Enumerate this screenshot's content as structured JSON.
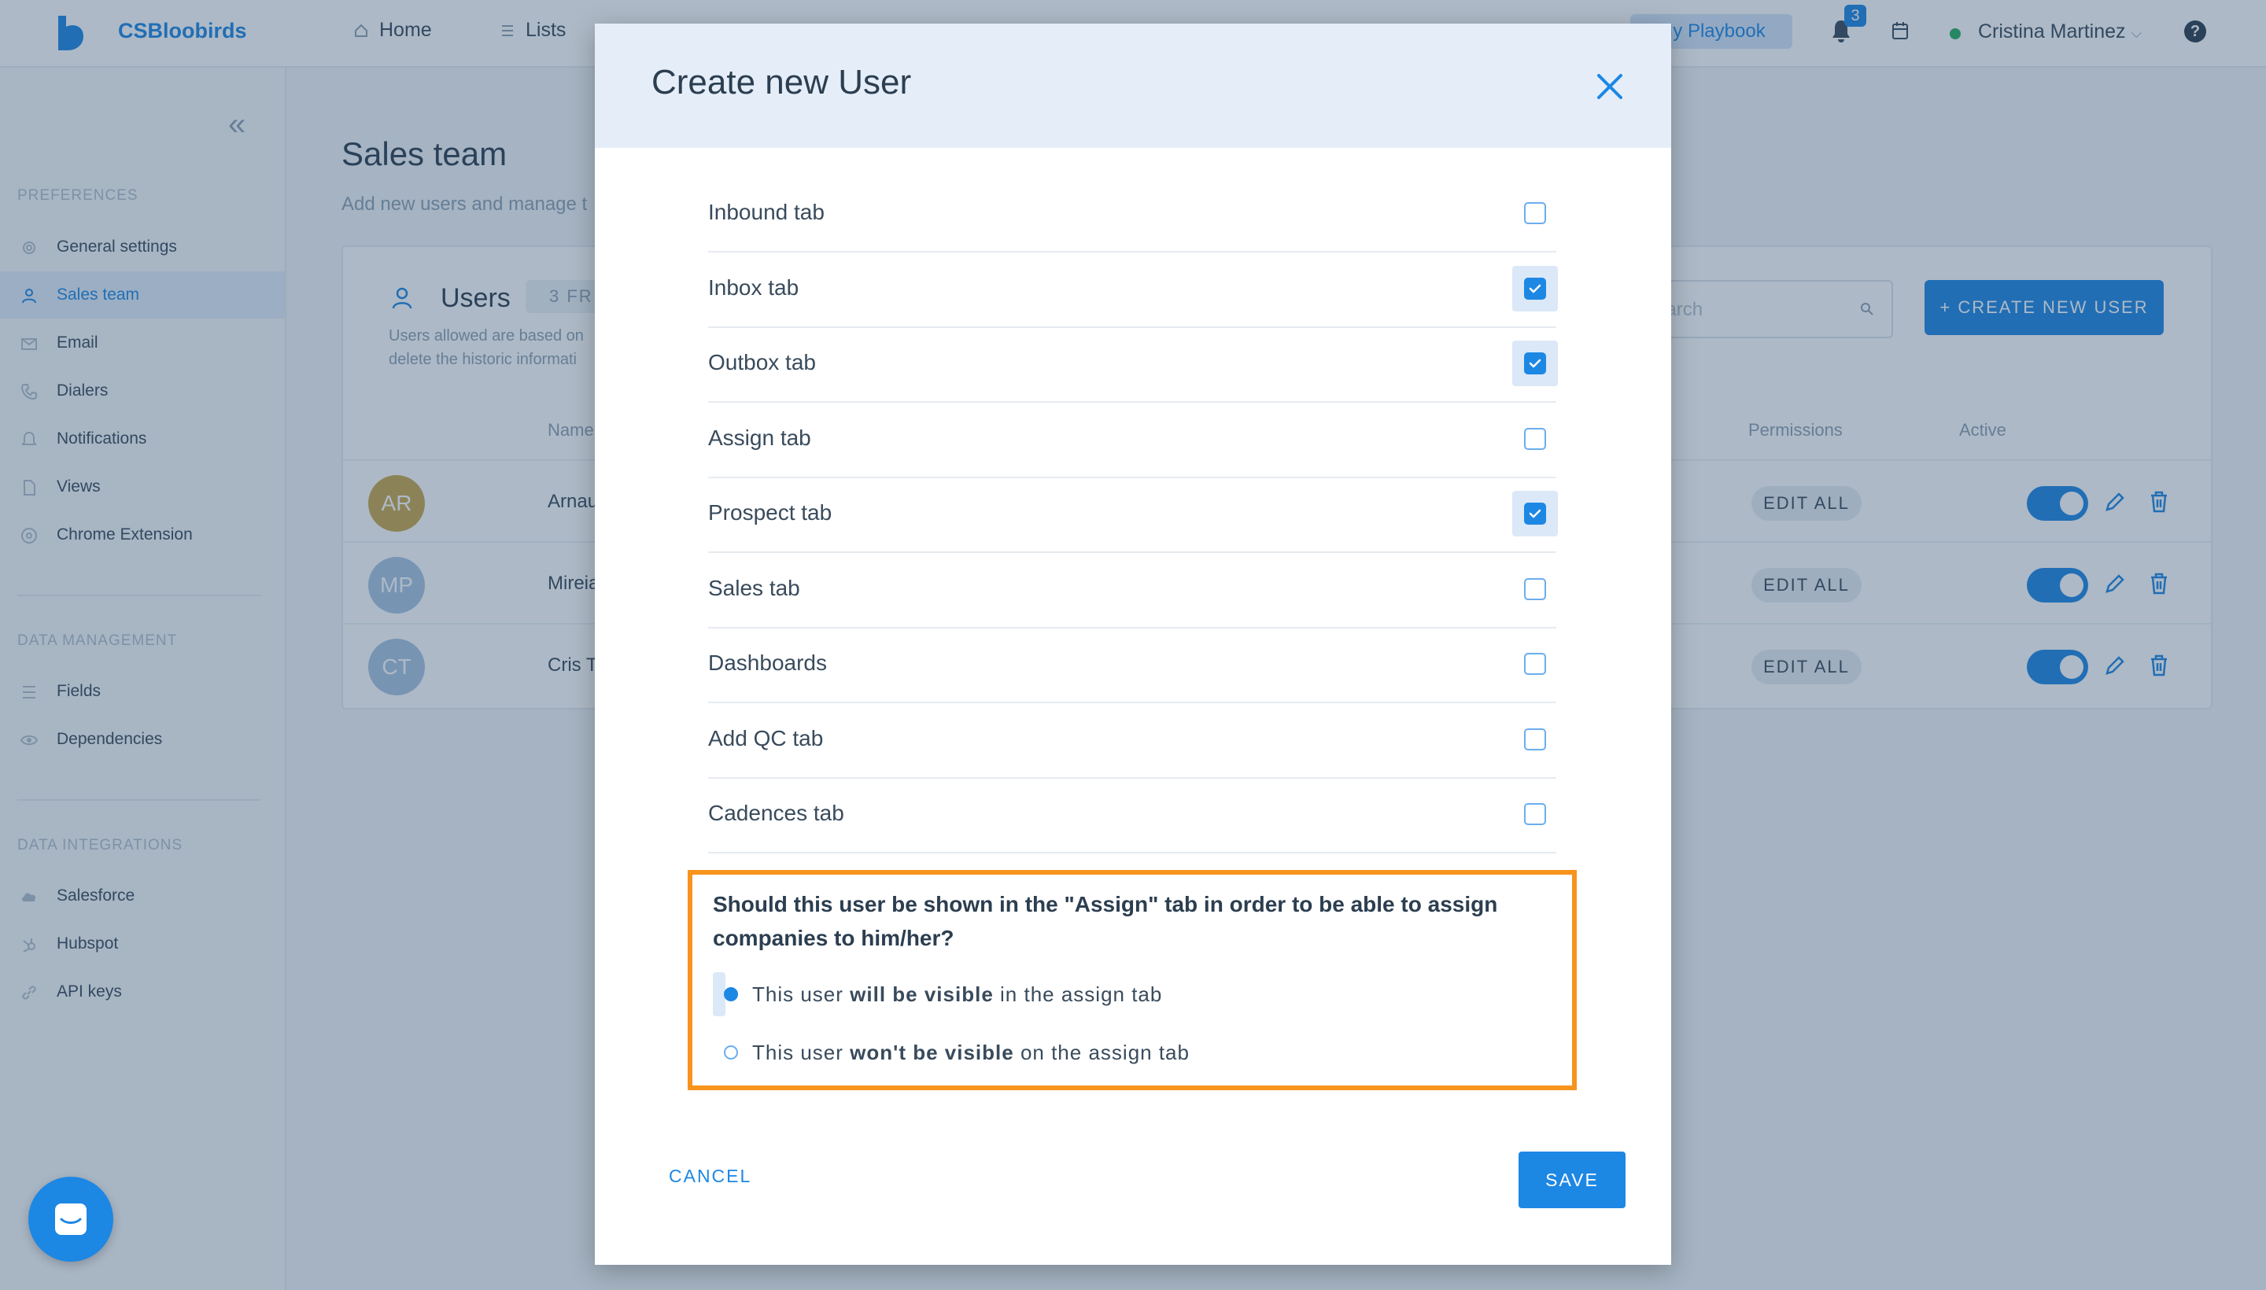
{
  "topbar": {
    "brand": "CSBloobirds",
    "nav": {
      "home": "Home",
      "lists": "Lists"
    },
    "playbook": "My Playbook",
    "notifications_count": "3",
    "user": "Cristina Martinez",
    "help": "?"
  },
  "sidebar": {
    "sections": [
      {
        "title": "PREFERENCES"
      },
      {
        "title": "DATA MANAGEMENT"
      },
      {
        "title": "DATA INTEGRATIONS"
      }
    ],
    "items": [
      {
        "label": "General settings"
      },
      {
        "label": "Sales team"
      },
      {
        "label": "Email"
      },
      {
        "label": "Dialers"
      },
      {
        "label": "Notifications"
      },
      {
        "label": "Views"
      },
      {
        "label": "Chrome Extension"
      },
      {
        "label": "Fields"
      },
      {
        "label": "Dependencies"
      },
      {
        "label": "Salesforce"
      },
      {
        "label": "Hubspot"
      },
      {
        "label": "API keys"
      }
    ]
  },
  "main": {
    "title": "Sales team",
    "subtitle": "Add new users and manage t",
    "users_title": "Users",
    "free_pill": "3 FR",
    "note": "Users allowed are based on delete the historic informati",
    "search_placeholder": "earch",
    "create_button": "+ CREATE NEW USER",
    "columns": {
      "name": "Name",
      "permissions": "Permissions",
      "active": "Active"
    },
    "rows": [
      {
        "initials": "AR",
        "name": "Arnau",
        "color": "#c9a84c",
        "permissions": "EDIT ALL"
      },
      {
        "initials": "MP",
        "name": "Mireia",
        "color": "#a9c3e0",
        "permissions": "EDIT ALL"
      },
      {
        "initials": "CT",
        "name": "Cris T",
        "color": "#a9c3e0",
        "permissions": "EDIT ALL"
      }
    ]
  },
  "modal": {
    "title": "Create new User",
    "permissions": [
      {
        "label": "Inbound tab",
        "checked": false
      },
      {
        "label": "Inbox tab",
        "checked": true
      },
      {
        "label": "Outbox tab",
        "checked": true
      },
      {
        "label": "Assign tab",
        "checked": false
      },
      {
        "label": "Prospect tab",
        "checked": true
      },
      {
        "label": "Sales tab",
        "checked": false
      },
      {
        "label": "Dashboards",
        "checked": false
      },
      {
        "label": "Add QC tab",
        "checked": false
      },
      {
        "label": "Cadences tab",
        "checked": false
      }
    ],
    "question": "Should this user be shown in the \"Assign\" tab in order to be able to assign companies to him/her?",
    "option_visible": {
      "pre": "This user ",
      "strong": "will be visible",
      "post": " in the assign tab",
      "selected": true
    },
    "option_hidden": {
      "pre": "This user ",
      "strong": "won't be visible",
      "post": " on the assign tab",
      "selected": false
    },
    "cancel": "CANCEL",
    "save": "SAVE"
  },
  "colors": {
    "accent": "#1d87e4",
    "highlight": "#f7941d"
  }
}
